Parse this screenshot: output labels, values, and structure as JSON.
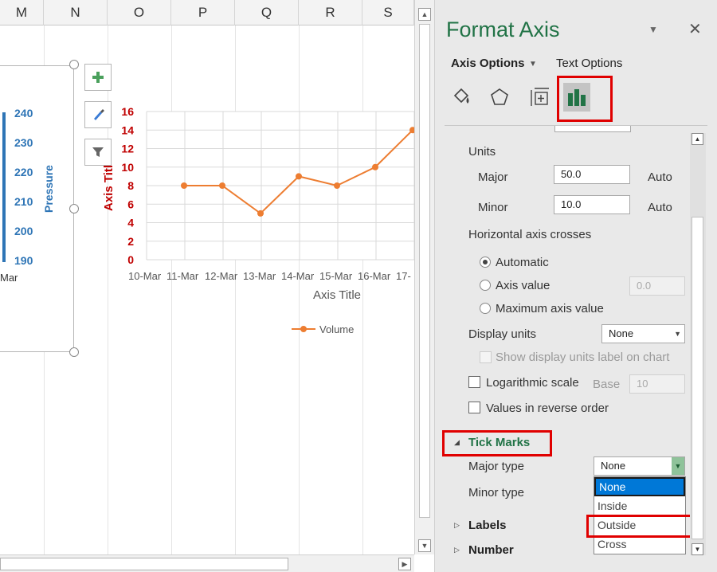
{
  "columns": [
    "M",
    "N",
    "O",
    "P",
    "Q",
    "R",
    "S"
  ],
  "left_chart": {
    "pressure_ticks": [
      "240",
      "230",
      "220",
      "210",
      "200",
      "190"
    ],
    "pressure_label": "Pressure",
    "x_label_fragment": "Mar"
  },
  "chart_buttons": [
    "chart-elements",
    "chart-styles",
    "chart-filters"
  ],
  "chart_data": {
    "type": "line",
    "categories": [
      "10-Mar",
      "11-Mar",
      "12-Mar",
      "13-Mar",
      "14-Mar",
      "15-Mar",
      "16-Mar",
      "17-"
    ],
    "series": [
      {
        "name": "Volume",
        "values": [
          null,
          8,
          8,
          5,
          9,
          8,
          10,
          14
        ],
        "color": "#ed7d31"
      }
    ],
    "y_ticks": [
      "0",
      "2",
      "4",
      "6",
      "8",
      "10",
      "12",
      "14",
      "16"
    ],
    "ylim": [
      0,
      16
    ],
    "xlabel": "Axis Title",
    "ylabel": "Axis Titl",
    "y_axis_color": "#c00000",
    "grid": true,
    "legend": "bottom"
  },
  "panel": {
    "title": "Format Axis",
    "tabs": {
      "axis_options": "Axis Options",
      "text_options": "Text Options"
    },
    "category_icons": [
      "fill-line-icon",
      "effects-icon",
      "size-properties-icon",
      "axis-options-icon"
    ],
    "units_label": "Units",
    "major_label": "Major",
    "major_value": "50.0",
    "major_auto": "Auto",
    "minor_label": "Minor",
    "minor_value": "10.0",
    "minor_auto": "Auto",
    "crosses_label": "Horizontal axis crosses",
    "automatic": "Automatic",
    "axis_value": "Axis value",
    "axis_value_field": "0.0",
    "max_axis_value": "Maximum axis value",
    "display_units_label": "Display units",
    "display_units_value": "None",
    "show_units_label": "Show display units label on chart",
    "log_scale": "Logarithmic scale",
    "base_label": "Base",
    "base_value": "10",
    "reverse_order": "Values in reverse order",
    "tick_marks": "Tick Marks",
    "major_type": "Major type",
    "major_type_value": "None",
    "minor_type": "Minor type",
    "tick_options": [
      "None",
      "Inside",
      "Outside",
      "Cross"
    ],
    "labels": "Labels",
    "number": "Number"
  },
  "colors": {
    "accent_green": "#217346",
    "highlight_red": "#e00000",
    "select_blue": "#0078d7"
  }
}
